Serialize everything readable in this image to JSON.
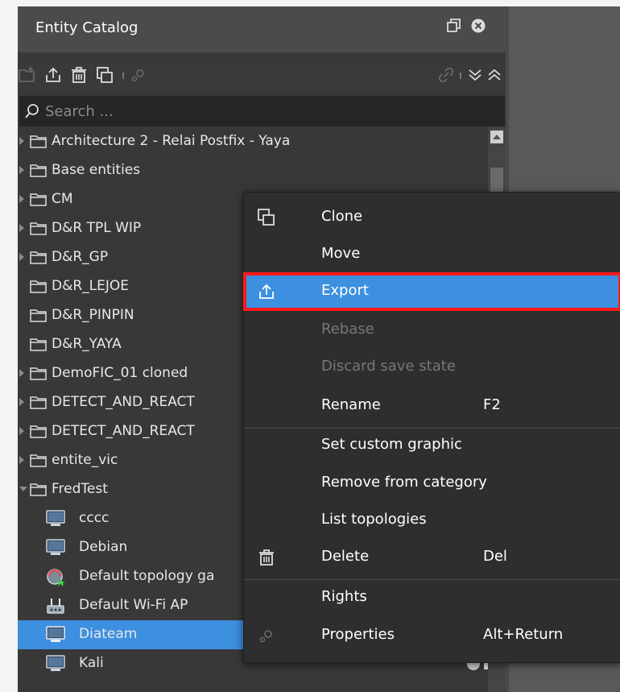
{
  "panel": {
    "title": "Entity Catalog"
  },
  "search": {
    "placeholder": "Search ..."
  },
  "tree": {
    "items": [
      {
        "label": "Architecture 2 - Relai Postfix - Yaya"
      },
      {
        "label": "Base entities"
      },
      {
        "label": "CM"
      },
      {
        "label": "D&R TPL WIP"
      },
      {
        "label": "D&R_GP"
      },
      {
        "label": "D&R_LEJOE"
      },
      {
        "label": "D&R_PINPIN"
      },
      {
        "label": "D&R_YAYA"
      },
      {
        "label": "DemoFIC_01 cloned"
      },
      {
        "label": "DETECT_AND_REACT"
      },
      {
        "label": "DETECT_AND_REACT"
      },
      {
        "label": "entite_vic"
      },
      {
        "label": "FredTest"
      },
      {
        "label": "cccc"
      },
      {
        "label": "Debian"
      },
      {
        "label": "Default topology ga"
      },
      {
        "label": "Default Wi-Fi AP"
      },
      {
        "label": "Diateam"
      },
      {
        "label": "Kali"
      }
    ]
  },
  "menu": {
    "items": [
      {
        "label": "Clone",
        "shortcut": "",
        "icon": "clone-icon",
        "disabled": false
      },
      {
        "label": "Move",
        "shortcut": "",
        "icon": "",
        "disabled": false
      },
      {
        "label": "Export",
        "shortcut": "",
        "icon": "export-icon",
        "disabled": false,
        "highlighted": true
      },
      {
        "label": "Rebase",
        "shortcut": "",
        "icon": "",
        "disabled": true
      },
      {
        "label": "Discard save state",
        "shortcut": "",
        "icon": "",
        "disabled": true
      },
      {
        "label": "Rename",
        "shortcut": "F2",
        "icon": "",
        "disabled": false
      },
      {
        "label": "Set custom graphic",
        "shortcut": "",
        "icon": "",
        "disabled": false
      },
      {
        "label": "Remove from category",
        "shortcut": "",
        "icon": "",
        "disabled": false
      },
      {
        "label": "List topologies",
        "shortcut": "",
        "icon": "",
        "disabled": false
      },
      {
        "label": "Delete",
        "shortcut": "Del",
        "icon": "trash-icon",
        "disabled": false
      },
      {
        "label": "Rights",
        "shortcut": "",
        "icon": "",
        "disabled": false
      },
      {
        "label": "Properties",
        "shortcut": "Alt+Return",
        "icon": "gear-icon",
        "disabled": false
      }
    ]
  },
  "colors": {
    "accent": "#3d8fe0",
    "highlight_border": "#ff1a1a",
    "panel_bg": "#383838"
  }
}
